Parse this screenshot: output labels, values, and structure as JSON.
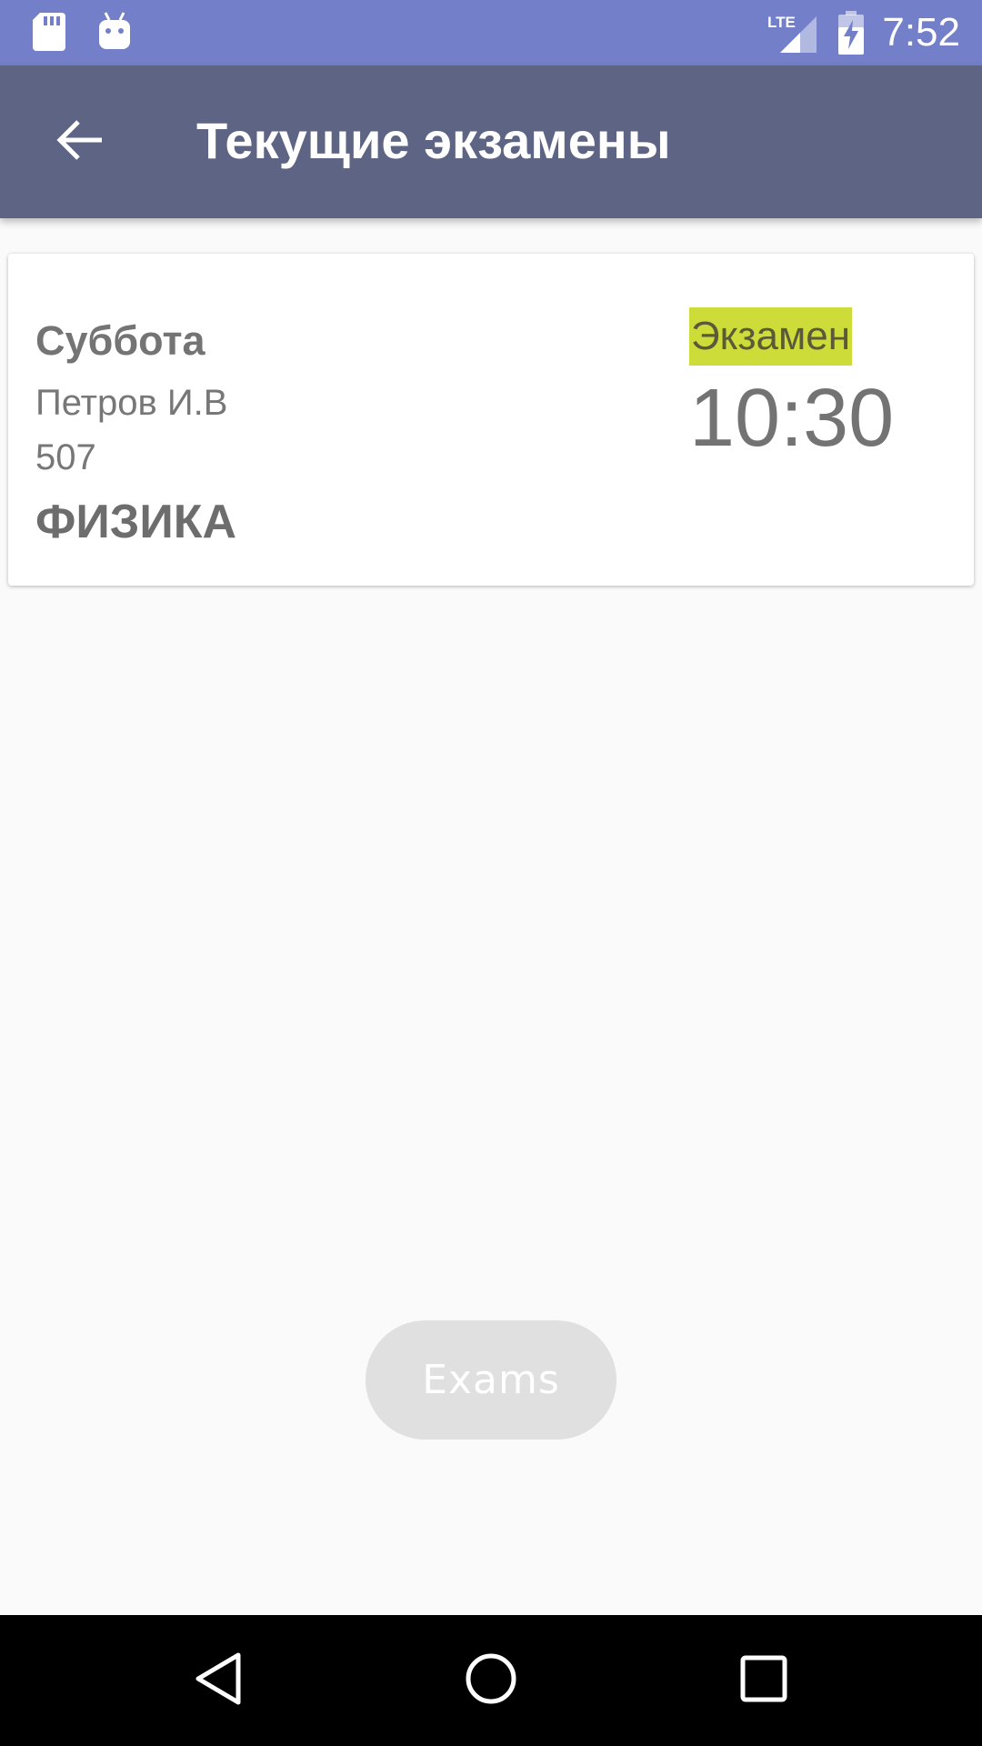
{
  "status_bar": {
    "time": "7:52",
    "network_label": "LTE",
    "icons": [
      "sd-card-icon",
      "android-icon",
      "lte-signal-icon",
      "battery-charging-icon"
    ]
  },
  "toolbar": {
    "title": "Текущие экзамены",
    "back_icon": "arrow-back-icon"
  },
  "exam_card": {
    "day": "Суббота",
    "teacher": "Петров И.В",
    "room": "507",
    "subject": "ФИЗИКА",
    "type": "Экзамен",
    "time": "10:30"
  },
  "exams_button": {
    "label": "Exams"
  },
  "nav_bar": {
    "buttons": [
      "back-nav-icon",
      "home-nav-icon",
      "recents-nav-icon"
    ]
  },
  "colors": {
    "status_bar": "#7380c9",
    "toolbar": "#5e6584",
    "badge": "#cddc39",
    "background": "#fafafa"
  }
}
